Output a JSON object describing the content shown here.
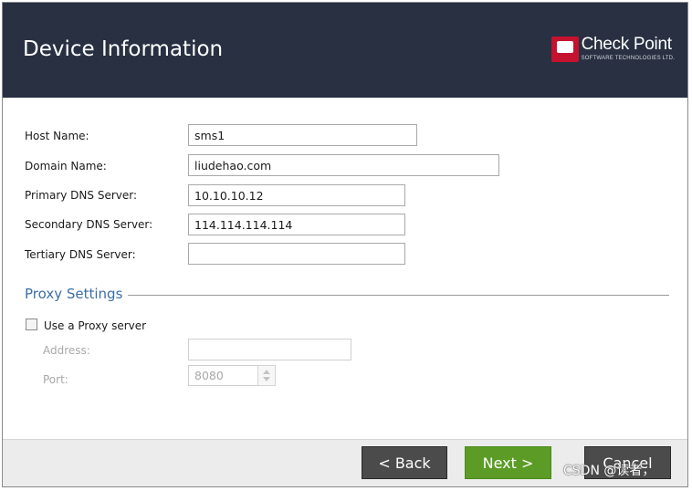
{
  "header": {
    "title": "Device Information",
    "logo_name": "Check Point",
    "logo_sub": "SOFTWARE TECHNOLOGIES LTD."
  },
  "form": {
    "host_name": {
      "label": "Host Name:",
      "value": "sms1"
    },
    "domain_name": {
      "label": "Domain Name:",
      "value": "liudehao.com"
    },
    "primary_dns": {
      "label": "Primary DNS Server:",
      "value": "10.10.10.12"
    },
    "secondary_dns": {
      "label": "Secondary DNS Server:",
      "value": "114.114.114.114"
    },
    "tertiary_dns": {
      "label": "Tertiary DNS Server:",
      "value": ""
    }
  },
  "proxy": {
    "section_title": "Proxy Settings",
    "use_proxy_label": "Use a Proxy server",
    "use_proxy_checked": false,
    "address": {
      "label": "Address:",
      "value": ""
    },
    "port": {
      "label": "Port:",
      "value": "8080"
    }
  },
  "footer": {
    "back_label": "< Back",
    "next_label": "Next >",
    "cancel_label": "Cancel"
  },
  "watermark": "CSDN @读者，",
  "colors": {
    "header_bg": "#283042",
    "section_title": "#3c6ea8",
    "next_button": "#5c9c26",
    "dark_button": "#4b4b4b",
    "logo_red": "#c4122f"
  }
}
